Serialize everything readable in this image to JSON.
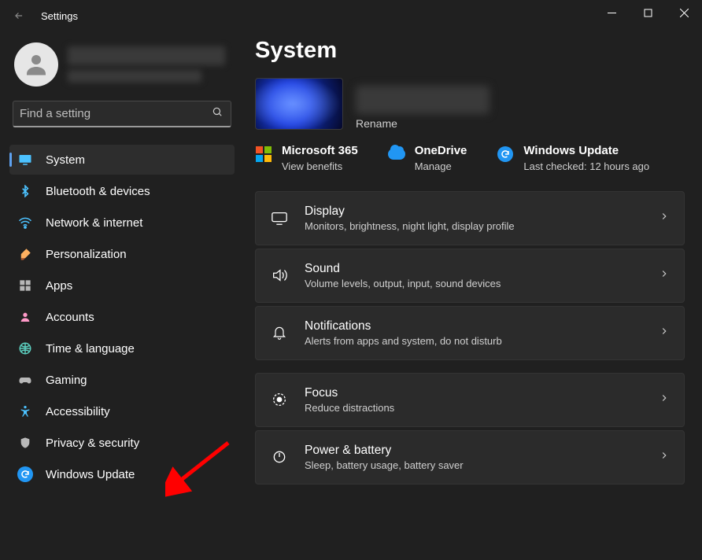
{
  "window": {
    "title": "Settings"
  },
  "search": {
    "placeholder": "Find a setting"
  },
  "sidebar": {
    "items": [
      {
        "id": "system",
        "label": "System",
        "icon": "monitor-icon",
        "selected": true
      },
      {
        "id": "bluetooth",
        "label": "Bluetooth & devices",
        "icon": "bluetooth-icon"
      },
      {
        "id": "network",
        "label": "Network & internet",
        "icon": "wifi-icon"
      },
      {
        "id": "personalization",
        "label": "Personalization",
        "icon": "paintbrush-icon"
      },
      {
        "id": "apps",
        "label": "Apps",
        "icon": "apps-icon"
      },
      {
        "id": "accounts",
        "label": "Accounts",
        "icon": "person-icon"
      },
      {
        "id": "time",
        "label": "Time & language",
        "icon": "clock-globe-icon"
      },
      {
        "id": "gaming",
        "label": "Gaming",
        "icon": "gamepad-icon"
      },
      {
        "id": "accessibility",
        "label": "Accessibility",
        "icon": "accessibility-icon"
      },
      {
        "id": "privacy",
        "label": "Privacy & security",
        "icon": "shield-icon"
      },
      {
        "id": "windowsupdate",
        "label": "Windows Update",
        "icon": "update-icon"
      }
    ]
  },
  "main": {
    "heading": "System",
    "rename": "Rename",
    "quick": [
      {
        "title": "Microsoft 365",
        "sub": "View benefits",
        "icon": "microsoft-logo-icon"
      },
      {
        "title": "OneDrive",
        "sub": "Manage",
        "icon": "onedrive-icon"
      },
      {
        "title": "Windows Update",
        "sub": "Last checked: 12 hours ago",
        "icon": "update-icon"
      }
    ],
    "cards": [
      {
        "title": "Display",
        "sub": "Monitors, brightness, night light, display profile",
        "icon": "display-icon"
      },
      {
        "title": "Sound",
        "sub": "Volume levels, output, input, sound devices",
        "icon": "sound-icon"
      },
      {
        "title": "Notifications",
        "sub": "Alerts from apps and system, do not disturb",
        "icon": "bell-icon"
      },
      {
        "title": "Focus",
        "sub": "Reduce distractions",
        "icon": "focus-icon"
      },
      {
        "title": "Power & battery",
        "sub": "Sleep, battery usage, battery saver",
        "icon": "power-icon"
      }
    ]
  },
  "annotation": {
    "type": "arrow",
    "color": "#ff0000",
    "points_to": "sidebar-item-windowsupdate"
  }
}
